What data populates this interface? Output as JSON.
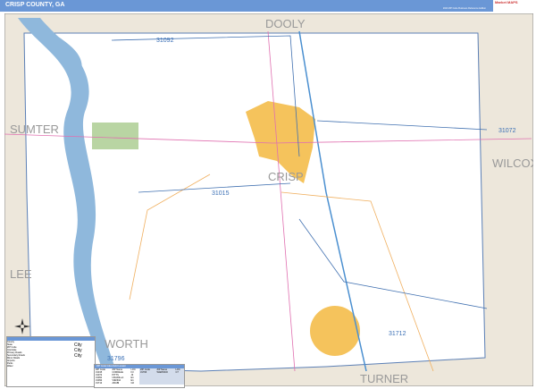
{
  "header": {
    "title": "CRISP COUNTY, GA",
    "edition": "2020 ZIP Code Business Reference Edition",
    "logo": "Market MAPS"
  },
  "counties": {
    "center": "CRISP",
    "north": "DOOLY",
    "west": "SUMTER",
    "east": "WILCOX",
    "southwest": "LEE",
    "south": "TURNER",
    "southwest2": "WORTH"
  },
  "zip_labels": [
    "31092",
    "31072",
    "31015",
    "31712",
    "31796"
  ],
  "legend": {
    "items": [
      "County",
      "State",
      "ZIP Code",
      "Interstate",
      "Primary Roads",
      "Secondary Roads",
      "Minor Roads",
      "Airports",
      "Parks",
      "Water"
    ],
    "cities": [
      "City",
      "City",
      "City",
      "City",
      "City",
      "City"
    ]
  },
  "zip_index": {
    "title": "ZIP Code Index/Grid Locator",
    "headers": [
      "ZIP Code",
      "ZIP Name",
      "LOC"
    ],
    "rows": [
      [
        "31015",
        "CORDELE",
        "F3"
      ],
      [
        "31072",
        "PITTS",
        "J3"
      ],
      [
        "31091",
        "UNADILLA",
        "E1"
      ],
      [
        "31092",
        "VIENNA",
        "E1"
      ],
      [
        "31712",
        "ARABI",
        "G6"
      ],
      [
        "31796",
        "WARWICK",
        "C7"
      ]
    ]
  },
  "colors": {
    "header": "#6a97d6",
    "land": "#ede7db",
    "county": "#ffffff",
    "water": "#8fb8dc",
    "city": "#f5c35c",
    "park": "#b9d5a3"
  }
}
